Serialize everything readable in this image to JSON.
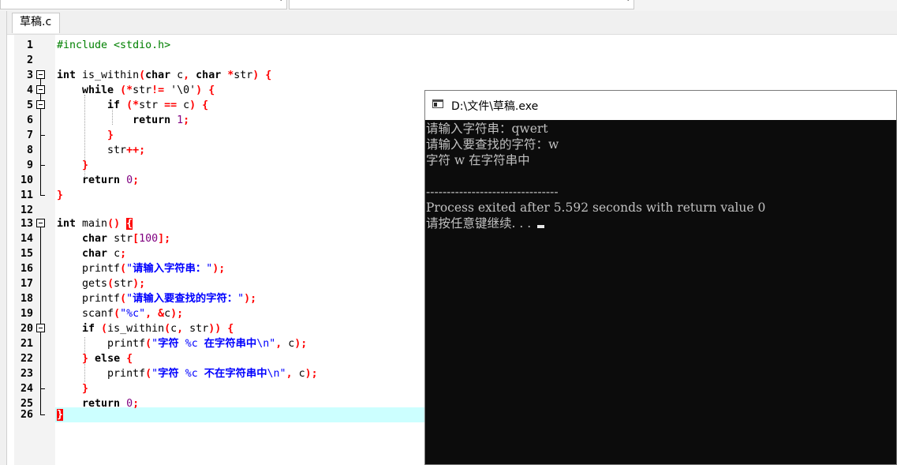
{
  "editor": {
    "tab_label": "草稿.c",
    "lines": [
      {
        "n": "1"
      },
      {
        "n": "2"
      },
      {
        "n": "3"
      },
      {
        "n": "4"
      },
      {
        "n": "5"
      },
      {
        "n": "6"
      },
      {
        "n": "7"
      },
      {
        "n": "8"
      },
      {
        "n": "9"
      },
      {
        "n": "10"
      },
      {
        "n": "11"
      },
      {
        "n": "12"
      },
      {
        "n": "13"
      },
      {
        "n": "14"
      },
      {
        "n": "15"
      },
      {
        "n": "16"
      },
      {
        "n": "17"
      },
      {
        "n": "18"
      },
      {
        "n": "19"
      },
      {
        "n": "20"
      },
      {
        "n": "21"
      },
      {
        "n": "22"
      },
      {
        "n": "23"
      },
      {
        "n": "24"
      },
      {
        "n": "25"
      },
      {
        "n": "26"
      }
    ],
    "code": {
      "l1": {
        "a": "#include <stdio.h>"
      },
      "l3": {
        "a": "int",
        "b": " is_within",
        "c": "(",
        "d": "char",
        "e": " c",
        ",": ",",
        "f": " char",
        "g": " ",
        "h": "*",
        "i": "str",
        ")": ")",
        "j": " ",
        "k": "{"
      },
      "l4": {
        "a": "while",
        "b": " (",
        "c": "*",
        "d": "str",
        "e": "!=",
        "f": " '\\0'",
        "g": ")",
        "h": " {"
      },
      "l5": {
        "a": "if",
        "b": " (",
        "c": "*",
        "d": "str ",
        "e": "==",
        "f": " c",
        "g": ")",
        "h": " {"
      },
      "l6": {
        "a": "return",
        "b": " 1",
        "c": ";"
      },
      "l7": {
        "a": "}"
      },
      "l8": {
        "a": "str",
        "b": "++;"
      },
      "l9": {
        "a": "}"
      },
      "l10": {
        "a": "return",
        "b": " 0",
        "c": ";"
      },
      "l11": {
        "a": "}"
      },
      "l13": {
        "a": "int",
        "b": " main",
        "c": "()",
        "d": " ",
        "e": "{"
      },
      "l14": {
        "a": "char",
        "b": " str",
        "c": "[",
        "d": "100",
        "e": "];"
      },
      "l15": {
        "a": "char",
        "b": " c",
        "c": ";"
      },
      "l16": {
        "a": "printf",
        "b": "(",
        "c": "\"",
        "d": "请输入字符串：",
        "e": "\"",
        "f": ");"
      },
      "l17": {
        "a": "gets",
        "b": "(",
        "c": "str",
        "d": ");"
      },
      "l18": {
        "a": "printf",
        "b": "(",
        "c": "\"",
        "d": "请输入要查找的字符：",
        "e": "\"",
        "f": ");"
      },
      "l19": {
        "a": "scanf",
        "b": "(",
        "c": "\"%c\"",
        ",": ",",
        "d": " &",
        "e": "c",
        "f": ");"
      },
      "l20": {
        "a": "if",
        "b": " (",
        "c": "is_within",
        "d": "(",
        "e": "c",
        ",": ",",
        "f": " str",
        "g": "))",
        "h": " {"
      },
      "l21": {
        "a": "printf",
        "b": "(",
        "c": "\"",
        "d": "字符",
        "e": " %c ",
        "f": "在字符串中",
        "g": "\\n\"",
        ",": ",",
        "h": " c",
        "i": ");"
      },
      "l22": {
        "a": "}",
        "b": " else",
        "c": " {"
      },
      "l23": {
        "a": "printf",
        "b": "(",
        "c": "\"",
        "d": "字符",
        "e": " %c ",
        "f": "不在字符串中",
        "g": "\\n\"",
        ",": ",",
        "h": " c",
        "i": ");"
      },
      "l24": {
        "a": "}"
      },
      "l25": {
        "a": "return",
        "b": " 0",
        "c": ";"
      },
      "l26": {
        "a": "}"
      }
    }
  },
  "console": {
    "title": "D:\\文件\\草稿.exe",
    "lines": [
      "请输入字符串：qwert",
      "请输入要查找的字符：w",
      "字符 w 在字符串中",
      "",
      "--------------------------------",
      "Process exited after 5.592 seconds with return value 0",
      "请按任意键继续. . . "
    ]
  },
  "colors": {
    "keyword": "#000000",
    "preprocessor": "#008000",
    "symbol": "#ff0000",
    "string": "#0000ff",
    "number": "#800080",
    "current_line": "#ccffff",
    "console_bg": "#0c0c0c",
    "console_text": "#c0c0c0"
  },
  "icons": [
    "fold-collapse-icon",
    "console-window-icon",
    "text-cursor-icon"
  ]
}
